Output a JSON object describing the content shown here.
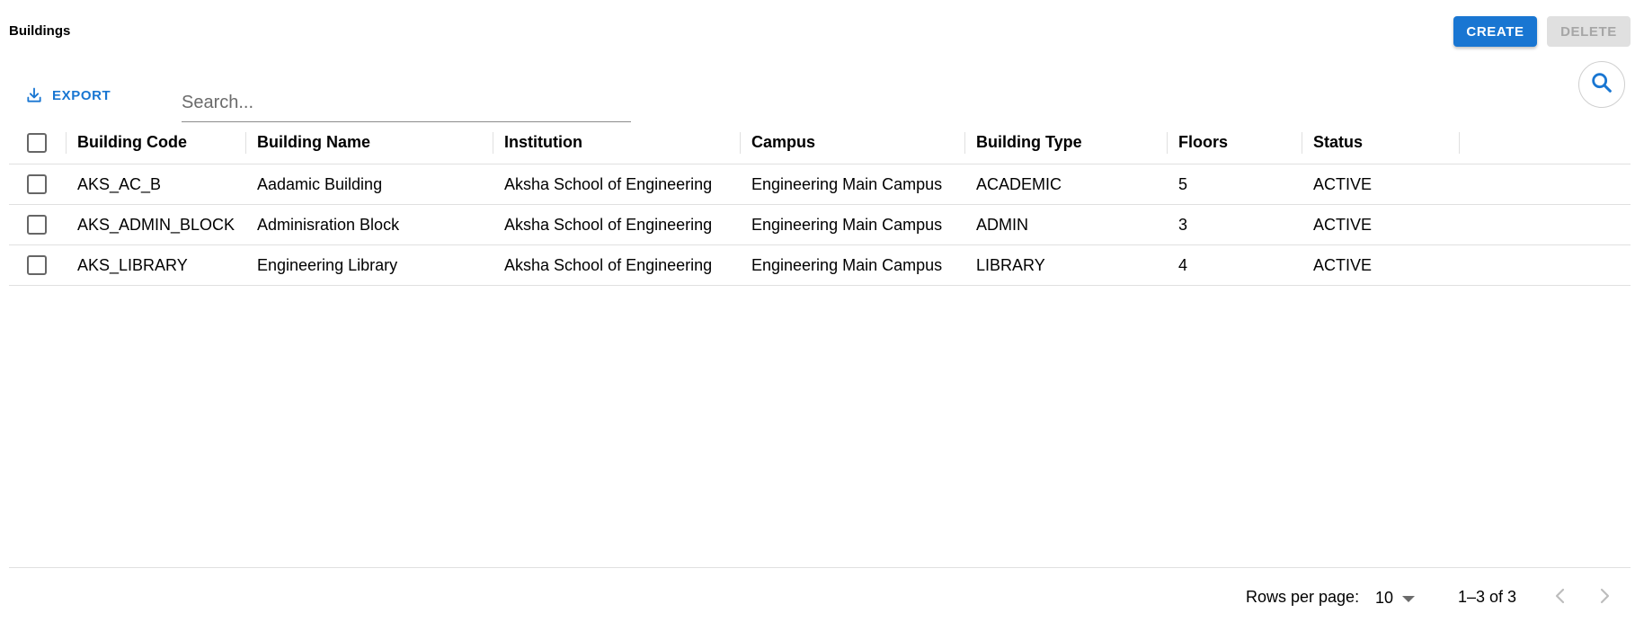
{
  "header": {
    "title": "Buildings",
    "create_label": "CREATE",
    "delete_label": "DELETE"
  },
  "toolbar": {
    "export_label": "EXPORT",
    "export_icon": "download-icon",
    "search_placeholder": "Search...",
    "search_value": "",
    "search_icon": "search-icon"
  },
  "table": {
    "columns": [
      "Building Code",
      "Building Name",
      "Institution",
      "Campus",
      "Building Type",
      "Floors",
      "Status"
    ],
    "rows": [
      [
        "AKS_AC_B",
        "Aadamic Building",
        "Aksha School of Engineering",
        "Engineering Main Campus",
        "ACADEMIC",
        "5",
        "ACTIVE"
      ],
      [
        "AKS_ADMIN_BLOCK",
        "Adminisration Block",
        "Aksha School of Engineering",
        "Engineering Main Campus",
        "ADMIN",
        "3",
        "ACTIVE"
      ],
      [
        "AKS_LIBRARY",
        "Engineering Library",
        "Aksha School of Engineering",
        "Engineering Main Campus",
        "LIBRARY",
        "4",
        "ACTIVE"
      ]
    ]
  },
  "pagination": {
    "rows_per_page_label": "Rows per page:",
    "rows_per_page_value": "10",
    "range_text": "1–3 of 3",
    "prev_icon": "chevron-left-icon",
    "next_icon": "chevron-right-icon"
  },
  "colors": {
    "primary": "#1976d2",
    "disabled_bg": "#e0e0e0",
    "disabled_text": "#a6a6a6"
  }
}
